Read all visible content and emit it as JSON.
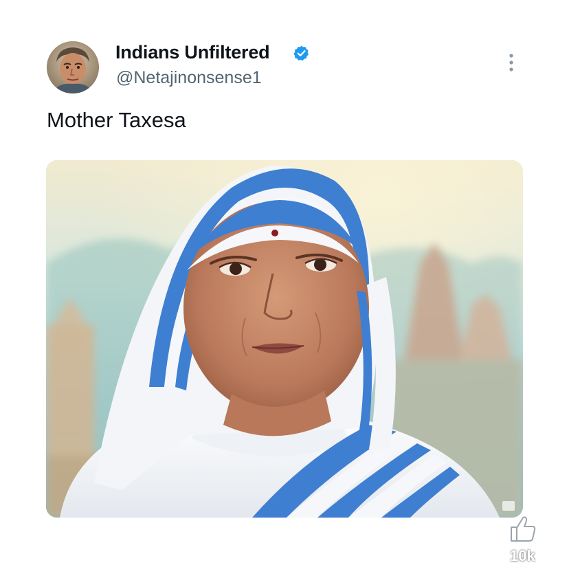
{
  "post": {
    "author": {
      "name": "Indians Unfiltered",
      "handle": "@Netajinonsense1",
      "verified": true
    },
    "text": "Mother Taxesa",
    "media": {
      "kind": "photo",
      "subject": "portrait"
    },
    "actions": {
      "like_icon": "thumbs-up-icon",
      "like_count": "10k",
      "more_icon": "more-options-icon"
    }
  },
  "colors": {
    "verified_badge": "#1d9bf0",
    "primary_text": "#0f1419",
    "secondary_text": "#536471",
    "habit_stripe": "#3f7fd1"
  }
}
